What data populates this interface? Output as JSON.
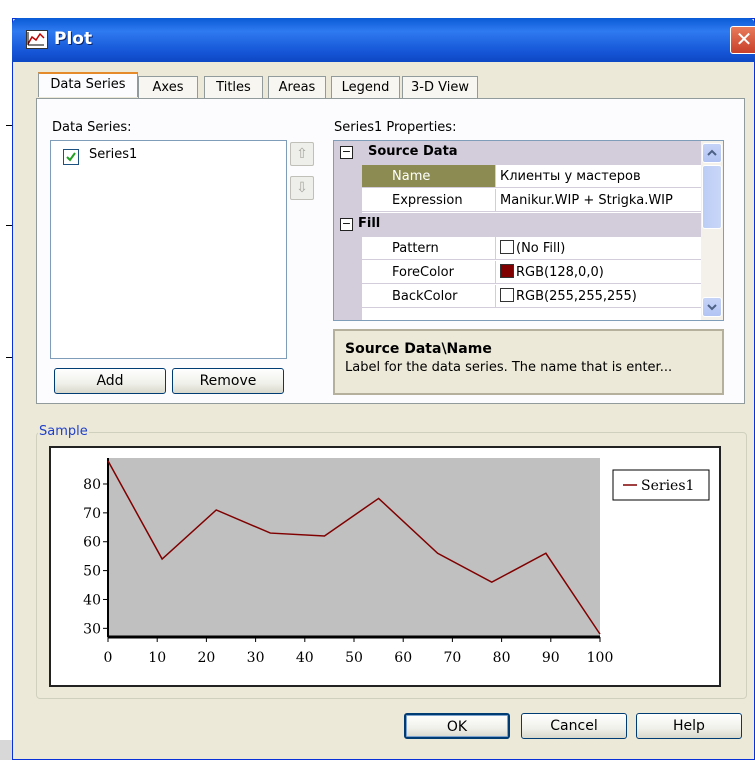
{
  "dialog": {
    "title": "Plot",
    "close_glyph": "✕",
    "tabs": [
      "Data Series",
      "Axes",
      "Titles",
      "Areas",
      "Legend",
      "3-D View"
    ],
    "active_tab": "Data Series"
  },
  "data_series": {
    "label": "Data Series:",
    "items": [
      {
        "name": "Series1",
        "checked": true
      }
    ],
    "move_up_glyph": "⇧",
    "move_down_glyph": "⇩",
    "add_label": "Add",
    "remove_label": "Remove"
  },
  "properties": {
    "label": "Series1 Properties:",
    "categories": [
      {
        "name": "Source Data",
        "expanded": true,
        "props": [
          {
            "name": "Name",
            "value": "Клиенты у мастеров",
            "selected": true
          },
          {
            "name": "Expression",
            "value": "Manikur.WIP + Strigka.WIP"
          }
        ]
      },
      {
        "name": "Fill",
        "expanded": true,
        "props": [
          {
            "name": "Pattern",
            "value": "(No Fill)",
            "swatch": "#ffffff"
          },
          {
            "name": "ForeColor",
            "value": "RGB(128,0,0)",
            "swatch": "#800000"
          },
          {
            "name": "BackColor",
            "value": "RGB(255,255,255)",
            "swatch": "#ffffff"
          }
        ]
      }
    ],
    "expand_glyph": "⊟",
    "help_title": "Source Data\\Name",
    "help_text": "Label for the data series. The name that is enter..."
  },
  "sample": {
    "label": "Sample"
  },
  "chart_data": {
    "type": "line",
    "x": [
      0,
      11,
      22,
      33,
      44,
      55,
      67,
      78,
      89,
      100
    ],
    "series": [
      {
        "name": "Series1",
        "values": [
          88,
          54,
          71,
          63,
          62,
          75,
          56,
          46,
          56,
          28
        ],
        "color": "#800000"
      }
    ],
    "xlim": [
      0,
      100
    ],
    "ylim": [
      27,
      89
    ],
    "xticks": [
      "0",
      "10",
      "20",
      "30",
      "40",
      "50",
      "60",
      "70",
      "80",
      "90",
      "100"
    ],
    "yticks": [
      "30",
      "40",
      "50",
      "60",
      "70",
      "80"
    ],
    "plot_background": "#c0c0c0",
    "legend_position": "right",
    "grid": false
  },
  "buttons": {
    "ok": "OK",
    "cancel": "Cancel",
    "help": "Help"
  },
  "colors": {
    "titlebar": "#0a5bd6",
    "dialog_bg": "#ece9d8",
    "selected_prop": "#8c8c52",
    "category_bg": "#d2ccdb",
    "series_line": "#800000"
  }
}
